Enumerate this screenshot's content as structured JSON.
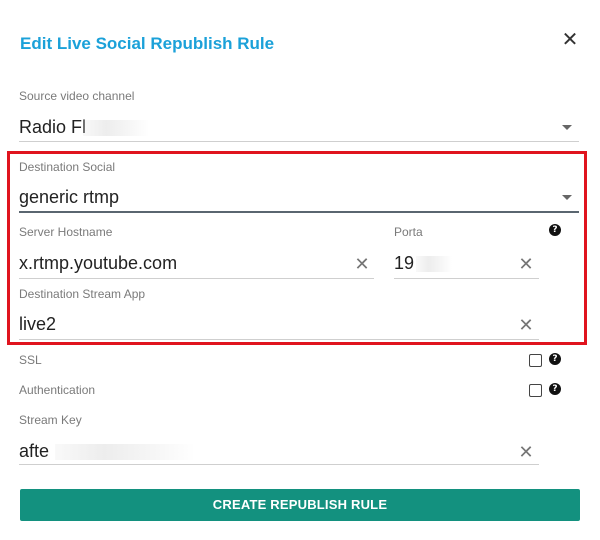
{
  "dialog": {
    "title": "Edit Live Social Republish Rule",
    "close_glyph": "✕"
  },
  "fields": {
    "source_channel": {
      "label": "Source video channel",
      "value": "Radio Fl"
    },
    "destination_social": {
      "label": "Destination Social",
      "value": "generic rtmp"
    },
    "server_hostname": {
      "label": "Server Hostname",
      "value": "x.rtmp.youtube.com"
    },
    "porta": {
      "label": "Porta",
      "value": "19"
    },
    "stream_app": {
      "label": "Destination Stream App",
      "value": "live2"
    },
    "ssl": {
      "label": "SSL",
      "checked": false
    },
    "authentication": {
      "label": "Authentication",
      "checked": false
    },
    "stream_key": {
      "label": "Stream Key",
      "value": "afte"
    }
  },
  "icons": {
    "clear": "✕",
    "help": "?"
  },
  "actions": {
    "submit_label": "CREATE REPUBLISH RULE"
  },
  "colors": {
    "title": "#1ba1d9",
    "button": "#13917f",
    "highlight": "#e0141e"
  }
}
